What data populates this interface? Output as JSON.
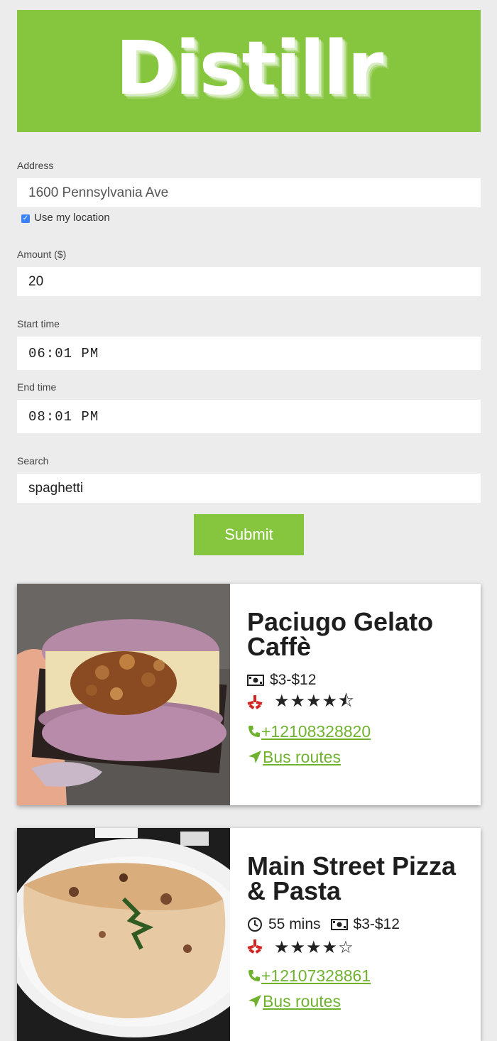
{
  "header": {
    "title": "Distillr"
  },
  "colors": {
    "accent": "#86c63f",
    "link": "#6fb22e",
    "yelp": "#d32323"
  },
  "form": {
    "address_label": "Address",
    "address_value": "1600 Pennsylvania Ave",
    "use_location_label": "Use my location",
    "use_location_checked": true,
    "amount_label": "Amount ($)",
    "amount_value": "20",
    "start_label": "Start time",
    "start_value": "06:01 PM",
    "end_label": "End time",
    "end_value": "08:01 PM",
    "search_label": "Search",
    "search_value": "spaghetti",
    "submit_label": "Submit"
  },
  "results": [
    {
      "name": "Paciugo Gelato Caffè",
      "duration": "",
      "price": "$3-$12",
      "rating": 4.5,
      "stars": "★★★★⯪",
      "phone": " +12108328820",
      "routes": " Bus routes",
      "icons": [
        "money-icon",
        "yelp-icon",
        "phone-icon",
        "location-arrow-icon"
      ]
    },
    {
      "name": "Main Street Pizza & Pasta",
      "duration": "55 mins",
      "price": "$3-$12",
      "rating": 4,
      "stars": "★★★★☆",
      "phone": " +12107328861",
      "routes": " Bus routes",
      "icons": [
        "clock-icon",
        "money-icon",
        "yelp-icon",
        "phone-icon",
        "location-arrow-icon"
      ]
    }
  ]
}
